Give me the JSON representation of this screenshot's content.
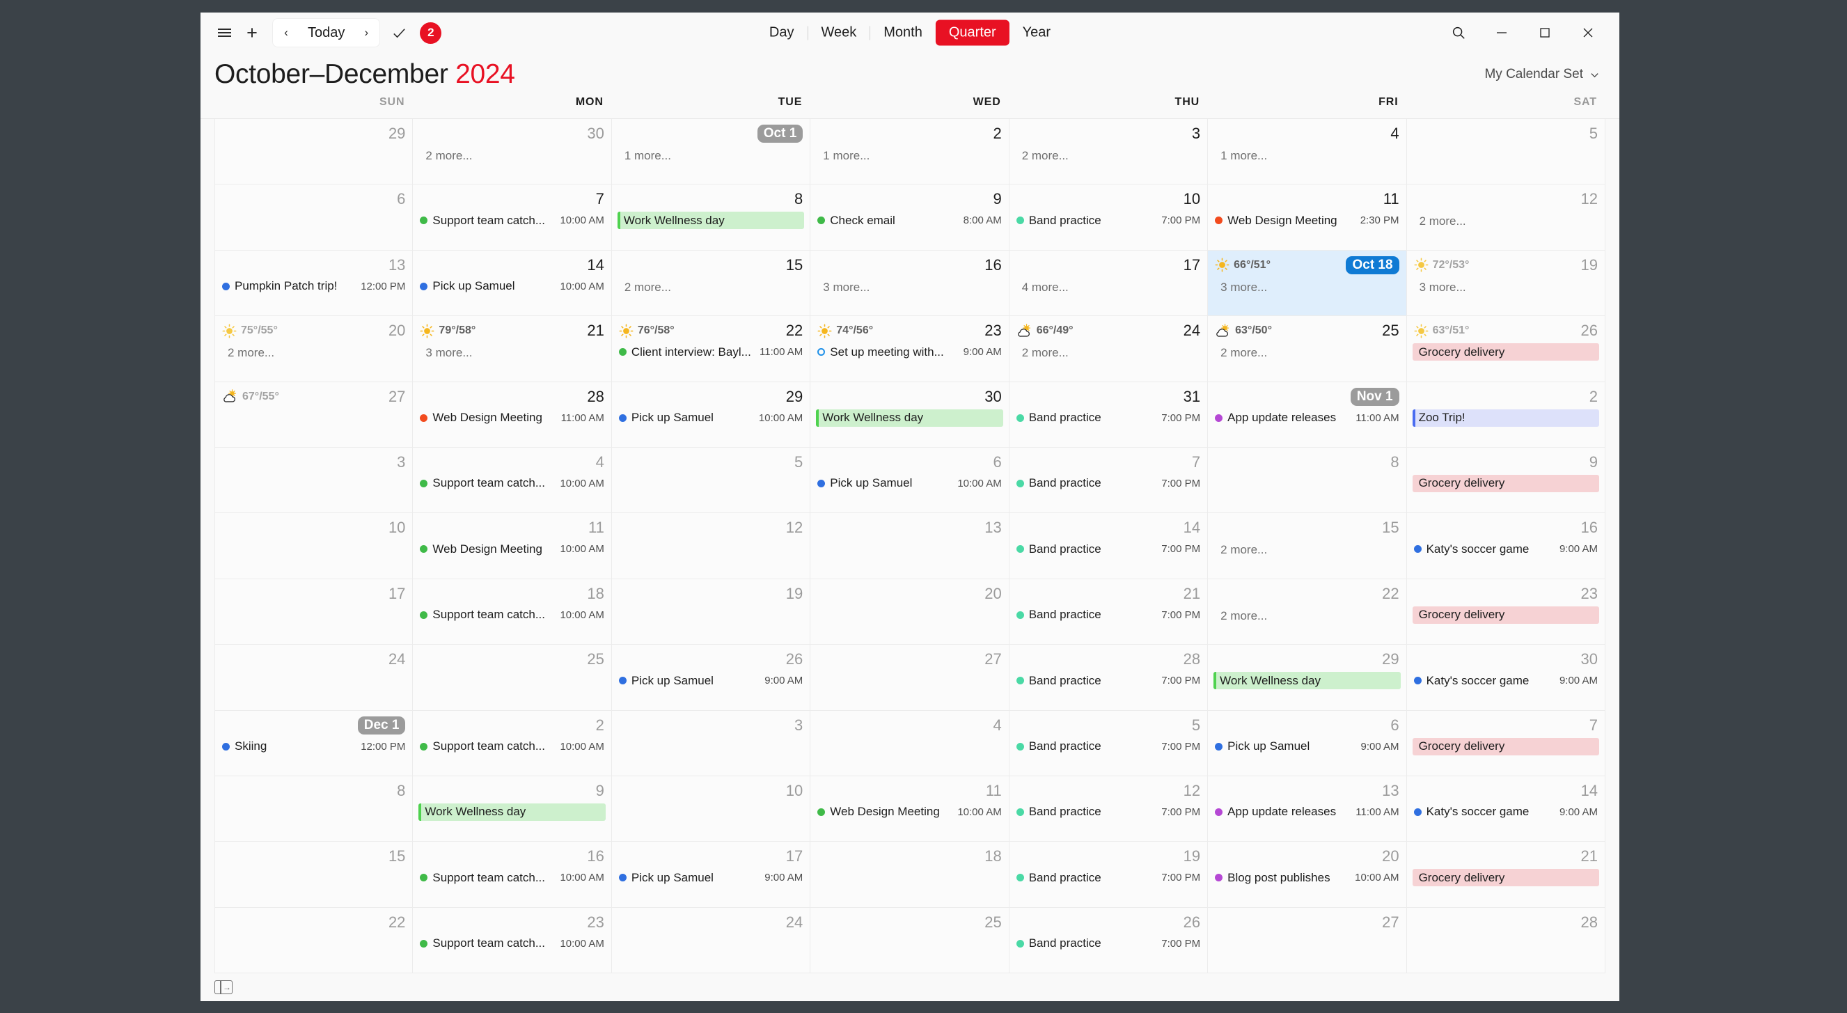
{
  "toolbar": {
    "menu_icon": "hamburger-icon",
    "add_icon": "plus-icon",
    "prev_label": "‹",
    "today_label": "Today",
    "next_label": "›",
    "check_icon": "checkmark-icon",
    "badge_count": "2",
    "views": [
      {
        "label": "Day",
        "active": false
      },
      {
        "label": "Week",
        "active": false
      },
      {
        "label": "Month",
        "active": false
      },
      {
        "label": "Quarter",
        "active": true
      },
      {
        "label": "Year",
        "active": false
      }
    ],
    "search_icon": "search-icon",
    "minimize_icon": "minimize-icon",
    "maximize_icon": "maximize-icon",
    "close_icon": "close-icon"
  },
  "header": {
    "title_main": "October–December",
    "title_year": "2024",
    "calendar_set": "My Calendar Set",
    "chevron": "chevron-down-icon"
  },
  "colors": {
    "accent_red": "#e81123",
    "today_blue": "#0f7ad4",
    "green_dot": "#3fba48",
    "teal_dot": "#4ad9a5",
    "blue_dot": "#2f6fe0",
    "purple_dot": "#b548d4",
    "orange_dot": "#f24b1e",
    "green_block_bg": "#cdf0cd",
    "green_block_bar": "#4fd24f",
    "pink_block_bg": "#f6d2d4",
    "blue_block_bg": "#dde1fa",
    "blue_block_bar": "#4a6cf0"
  },
  "dow": [
    {
      "label": "SUN",
      "dim": true
    },
    {
      "label": "MON",
      "dim": false
    },
    {
      "label": "TUE",
      "dim": false
    },
    {
      "label": "WED",
      "dim": false
    },
    {
      "label": "THU",
      "dim": false
    },
    {
      "label": "FRI",
      "dim": false
    },
    {
      "label": "SAT",
      "dim": true
    }
  ],
  "footer": {
    "expand_icon": "expand-panel-icon"
  },
  "weeks": [
    {
      "days": [
        {
          "num": "29",
          "dim": true
        },
        {
          "num": "30",
          "dim": true,
          "more": "2 more..."
        },
        {
          "num": "Oct 1",
          "pill": "grey",
          "more": "1 more..."
        },
        {
          "num": "2",
          "more": "1 more..."
        },
        {
          "num": "3",
          "more": "2 more..."
        },
        {
          "num": "4",
          "more": "1 more..."
        },
        {
          "num": "5",
          "dim": true
        }
      ]
    },
    {
      "days": [
        {
          "num": "6",
          "dim": true
        },
        {
          "num": "7",
          "events": [
            {
              "title": "Support team catch...",
              "time": "10:00 AM",
              "dot": "green_dot"
            }
          ]
        },
        {
          "num": "8",
          "events": [
            {
              "title": "Work Wellness day",
              "block": "green"
            }
          ]
        },
        {
          "num": "9",
          "events": [
            {
              "title": "Check email",
              "time": "8:00 AM",
              "dot": "green_dot"
            }
          ]
        },
        {
          "num": "10",
          "events": [
            {
              "title": "Band practice",
              "time": "7:00 PM",
              "dot": "teal_dot"
            }
          ]
        },
        {
          "num": "11",
          "events": [
            {
              "title": "Web Design Meeting",
              "time": "2:30 PM",
              "dot": "orange_dot"
            }
          ]
        },
        {
          "num": "12",
          "dim": true,
          "more": "2 more..."
        }
      ]
    },
    {
      "days": [
        {
          "num": "13",
          "dim": true,
          "events": [
            {
              "title": "Pumpkin Patch trip!",
              "time": "12:00 PM",
              "dot": "blue_dot"
            }
          ]
        },
        {
          "num": "14",
          "events": [
            {
              "title": "Pick up Samuel",
              "time": "10:00 AM",
              "dot": "blue_dot"
            }
          ]
        },
        {
          "num": "15",
          "more": "2 more..."
        },
        {
          "num": "16",
          "more": "3 more..."
        },
        {
          "num": "17",
          "more": "4 more..."
        },
        {
          "num": "Oct 18",
          "pill": "blue",
          "today": true,
          "weather": {
            "icon": "sun",
            "temps": "66°/51°"
          },
          "more": "3 more..."
        },
        {
          "num": "19",
          "dim": true,
          "weather": {
            "icon": "sun",
            "temps": "72°/53°",
            "dim": true
          },
          "more": "3 more..."
        }
      ]
    },
    {
      "days": [
        {
          "num": "20",
          "dim": true,
          "weather": {
            "icon": "sun",
            "temps": "75°/55°",
            "dim": true
          },
          "more": "2 more..."
        },
        {
          "num": "21",
          "weather": {
            "icon": "sun",
            "temps": "79°/58°"
          },
          "more": "3 more..."
        },
        {
          "num": "22",
          "weather": {
            "icon": "sun",
            "temps": "76°/58°"
          },
          "events": [
            {
              "title": "Client interview: Bayl...",
              "time": "11:00 AM",
              "dot": "green_dot"
            }
          ]
        },
        {
          "num": "23",
          "weather": {
            "icon": "sun",
            "temps": "74°/56°"
          },
          "events": [
            {
              "title": "Set up meeting with...",
              "time": "9:00 AM",
              "dot": "hollow_blue"
            }
          ]
        },
        {
          "num": "24",
          "weather": {
            "icon": "partly",
            "temps": "66°/49°"
          },
          "more": "2 more..."
        },
        {
          "num": "25",
          "weather": {
            "icon": "partly",
            "temps": "63°/50°"
          },
          "more": "2 more..."
        },
        {
          "num": "26",
          "dim": true,
          "weather": {
            "icon": "sun",
            "temps": "63°/51°",
            "dim": true
          },
          "events": [
            {
              "title": "Grocery delivery",
              "block": "pink"
            }
          ]
        }
      ]
    },
    {
      "days": [
        {
          "num": "27",
          "dim": true,
          "weather": {
            "icon": "partly",
            "temps": "67°/55°",
            "dim": true
          }
        },
        {
          "num": "28",
          "events": [
            {
              "title": "Web Design Meeting",
              "time": "11:00 AM",
              "dot": "orange_dot"
            }
          ]
        },
        {
          "num": "29",
          "events": [
            {
              "title": "Pick up Samuel",
              "time": "10:00 AM",
              "dot": "blue_dot"
            }
          ]
        },
        {
          "num": "30",
          "events": [
            {
              "title": "Work Wellness day",
              "block": "green"
            }
          ]
        },
        {
          "num": "31",
          "events": [
            {
              "title": "Band practice",
              "time": "7:00 PM",
              "dot": "teal_dot"
            }
          ]
        },
        {
          "num": "Nov 1",
          "pill": "grey",
          "events": [
            {
              "title": "App update releases",
              "time": "11:00 AM",
              "dot": "purple_dot"
            }
          ]
        },
        {
          "num": "2",
          "dim": true,
          "events": [
            {
              "title": "Zoo Trip!",
              "block": "blue"
            }
          ]
        }
      ]
    },
    {
      "days": [
        {
          "num": "3",
          "dim": true
        },
        {
          "num": "4",
          "dim": true,
          "events": [
            {
              "title": "Support team catch...",
              "time": "10:00 AM",
              "dot": "green_dot"
            }
          ]
        },
        {
          "num": "5",
          "dim": true
        },
        {
          "num": "6",
          "dim": true,
          "events": [
            {
              "title": "Pick up Samuel",
              "time": "10:00 AM",
              "dot": "blue_dot"
            }
          ]
        },
        {
          "num": "7",
          "dim": true,
          "events": [
            {
              "title": "Band practice",
              "time": "7:00 PM",
              "dot": "teal_dot"
            }
          ]
        },
        {
          "num": "8",
          "dim": true
        },
        {
          "num": "9",
          "dim": true,
          "events": [
            {
              "title": "Grocery delivery",
              "block": "pink"
            }
          ]
        }
      ]
    },
    {
      "days": [
        {
          "num": "10",
          "dim": true
        },
        {
          "num": "11",
          "dim": true,
          "events": [
            {
              "title": "Web Design Meeting",
              "time": "10:00 AM",
              "dot": "green_dot"
            }
          ]
        },
        {
          "num": "12",
          "dim": true
        },
        {
          "num": "13",
          "dim": true
        },
        {
          "num": "14",
          "dim": true,
          "events": [
            {
              "title": "Band practice",
              "time": "7:00 PM",
              "dot": "teal_dot"
            }
          ]
        },
        {
          "num": "15",
          "dim": true,
          "more": "2 more..."
        },
        {
          "num": "16",
          "dim": true,
          "events": [
            {
              "title": "Katy's soccer game",
              "time": "9:00 AM",
              "dot": "blue_dot"
            }
          ]
        }
      ]
    },
    {
      "days": [
        {
          "num": "17",
          "dim": true
        },
        {
          "num": "18",
          "dim": true,
          "events": [
            {
              "title": "Support team catch...",
              "time": "10:00 AM",
              "dot": "green_dot"
            }
          ]
        },
        {
          "num": "19",
          "dim": true
        },
        {
          "num": "20",
          "dim": true
        },
        {
          "num": "21",
          "dim": true,
          "events": [
            {
              "title": "Band practice",
              "time": "7:00 PM",
              "dot": "teal_dot"
            }
          ]
        },
        {
          "num": "22",
          "dim": true,
          "more": "2 more..."
        },
        {
          "num": "23",
          "dim": true,
          "events": [
            {
              "title": "Grocery delivery",
              "block": "pink"
            }
          ]
        }
      ]
    },
    {
      "days": [
        {
          "num": "24",
          "dim": true
        },
        {
          "num": "25",
          "dim": true
        },
        {
          "num": "26",
          "dim": true,
          "events": [
            {
              "title": "Pick up Samuel",
              "time": "9:00 AM",
              "dot": "blue_dot"
            }
          ]
        },
        {
          "num": "27",
          "dim": true
        },
        {
          "num": "28",
          "dim": true,
          "events": [
            {
              "title": "Band practice",
              "time": "7:00 PM",
              "dot": "teal_dot"
            }
          ]
        },
        {
          "num": "29",
          "dim": true,
          "events": [
            {
              "title": "Work Wellness day",
              "block": "green"
            }
          ]
        },
        {
          "num": "30",
          "dim": true,
          "events": [
            {
              "title": "Katy's soccer game",
              "time": "9:00 AM",
              "dot": "blue_dot"
            }
          ]
        }
      ]
    },
    {
      "days": [
        {
          "num": "Dec 1",
          "pill": "grey",
          "events": [
            {
              "title": "Skiing",
              "time": "12:00 PM",
              "dot": "blue_dot"
            }
          ]
        },
        {
          "num": "2",
          "dim": true,
          "events": [
            {
              "title": "Support team catch...",
              "time": "10:00 AM",
              "dot": "green_dot"
            }
          ]
        },
        {
          "num": "3",
          "dim": true
        },
        {
          "num": "4",
          "dim": true
        },
        {
          "num": "5",
          "dim": true,
          "events": [
            {
              "title": "Band practice",
              "time": "7:00 PM",
              "dot": "teal_dot"
            }
          ]
        },
        {
          "num": "6",
          "dim": true,
          "events": [
            {
              "title": "Pick up Samuel",
              "time": "9:00 AM",
              "dot": "blue_dot"
            }
          ]
        },
        {
          "num": "7",
          "dim": true,
          "events": [
            {
              "title": "Grocery delivery",
              "block": "pink"
            }
          ]
        }
      ]
    },
    {
      "days": [
        {
          "num": "8",
          "dim": true
        },
        {
          "num": "9",
          "dim": true,
          "events": [
            {
              "title": "Work Wellness day",
              "block": "green"
            }
          ]
        },
        {
          "num": "10",
          "dim": true
        },
        {
          "num": "11",
          "dim": true,
          "events": [
            {
              "title": "Web Design Meeting",
              "time": "10:00 AM",
              "dot": "green_dot"
            }
          ]
        },
        {
          "num": "12",
          "dim": true,
          "events": [
            {
              "title": "Band practice",
              "time": "7:00 PM",
              "dot": "teal_dot"
            }
          ]
        },
        {
          "num": "13",
          "dim": true,
          "events": [
            {
              "title": "App update releases",
              "time": "11:00 AM",
              "dot": "purple_dot"
            }
          ]
        },
        {
          "num": "14",
          "dim": true,
          "events": [
            {
              "title": "Katy's soccer game",
              "time": "9:00 AM",
              "dot": "blue_dot"
            }
          ]
        }
      ]
    },
    {
      "days": [
        {
          "num": "15",
          "dim": true
        },
        {
          "num": "16",
          "dim": true,
          "events": [
            {
              "title": "Support team catch...",
              "time": "10:00 AM",
              "dot": "green_dot"
            }
          ]
        },
        {
          "num": "17",
          "dim": true,
          "events": [
            {
              "title": "Pick up Samuel",
              "time": "9:00 AM",
              "dot": "blue_dot"
            }
          ]
        },
        {
          "num": "18",
          "dim": true
        },
        {
          "num": "19",
          "dim": true,
          "events": [
            {
              "title": "Band practice",
              "time": "7:00 PM",
              "dot": "teal_dot"
            }
          ]
        },
        {
          "num": "20",
          "dim": true,
          "events": [
            {
              "title": "Blog post publishes",
              "time": "10:00 AM",
              "dot": "purple_dot"
            }
          ]
        },
        {
          "num": "21",
          "dim": true,
          "events": [
            {
              "title": "Grocery delivery",
              "block": "pink"
            }
          ]
        }
      ]
    },
    {
      "days": [
        {
          "num": "22",
          "dim": true
        },
        {
          "num": "23",
          "dim": true,
          "events": [
            {
              "title": "Support team catch...",
              "time": "10:00 AM",
              "dot": "green_dot"
            }
          ]
        },
        {
          "num": "24",
          "dim": true
        },
        {
          "num": "25",
          "dim": true
        },
        {
          "num": "26",
          "dim": true,
          "events": [
            {
              "title": "Band practice",
              "time": "7:00 PM",
              "dot": "teal_dot"
            }
          ]
        },
        {
          "num": "27",
          "dim": true
        },
        {
          "num": "28",
          "dim": true
        }
      ]
    }
  ]
}
